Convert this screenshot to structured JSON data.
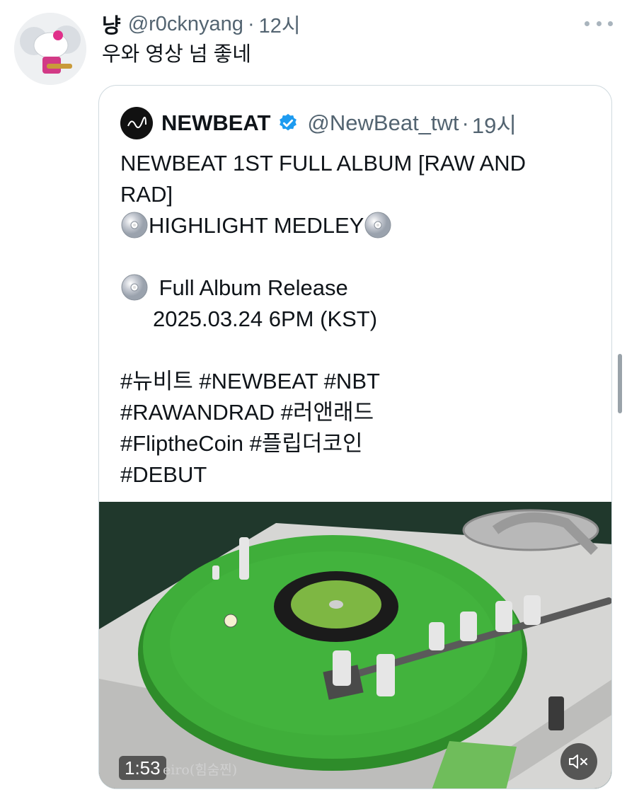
{
  "outer_tweet": {
    "author_name": "냥",
    "handle": "@r0cknyang",
    "separator": "·",
    "time": "12시",
    "text": "우와 영상 넘 좋네",
    "more_icon": "more-horizontal-icon"
  },
  "quoted_tweet": {
    "author_name": "NEWBEAT",
    "verified_icon": "verified-badge-icon",
    "handle": "@NewBeat_twt",
    "separator": "·",
    "time": "19시",
    "lines": {
      "l1": "NEWBEAT 1ST FULL ALBUM [RAW AND",
      "l2": "RAD]",
      "l3": "HIGHLIGHT MEDLEY",
      "l4": "Full Album Release",
      "l5": "2025.03.24 6PM (KST)",
      "l6": "#뉴비트 #NEWBEAT #NBT",
      "l7": "#RAWANDRAD #러앤래드",
      "l8": "#FliptheCoin #플립더코인",
      "l9": "#DEBUT"
    },
    "emoji_icon": "cd-disc-icon"
  },
  "video": {
    "duration": "1:53",
    "caption": "eiro(힘숨찐)",
    "mute_icon": "speaker-muted-icon",
    "colors": {
      "record": "#3fae3a",
      "background": "#1d3328",
      "turntable": "#dcdcdc"
    }
  }
}
